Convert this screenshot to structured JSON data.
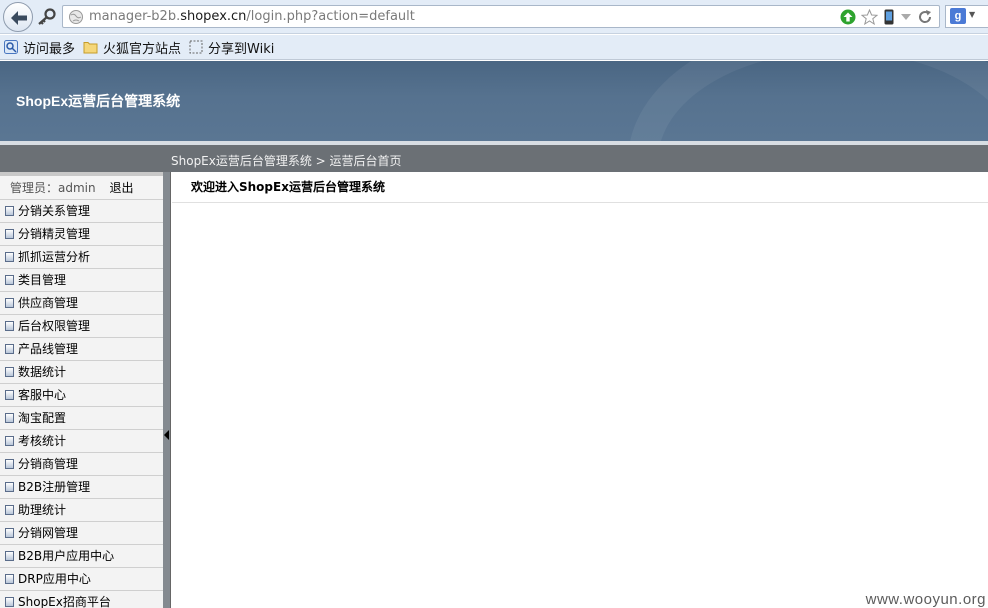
{
  "browser": {
    "url_prefix": "manager-b2b.",
    "url_domain": "shopex.cn",
    "url_path": "/login.php?action=default"
  },
  "bookmarks": [
    {
      "label": "访问最多",
      "icon": "most-visited-icon"
    },
    {
      "label": "火狐官方站点",
      "icon": "folder-icon"
    },
    {
      "label": "分享到Wiki",
      "icon": "share-icon"
    }
  ],
  "header": {
    "title": "ShopEx运营后台管理系统"
  },
  "breadcrumb": "ShopEx运营后台管理系统 > 运营后台首页",
  "sidebar": {
    "admin_label": "管理员：admin",
    "logout_label": "退出",
    "items": [
      {
        "label": "分销关系管理"
      },
      {
        "label": "分销精灵管理"
      },
      {
        "label": "抓抓运营分析"
      },
      {
        "label": "类目管理"
      },
      {
        "label": "供应商管理"
      },
      {
        "label": "后台权限管理"
      },
      {
        "label": "产品线管理"
      },
      {
        "label": "数据统计"
      },
      {
        "label": "客服中心"
      },
      {
        "label": "淘宝配置"
      },
      {
        "label": "考核统计"
      },
      {
        "label": "分销商管理"
      },
      {
        "label": "B2B注册管理"
      },
      {
        "label": "助理统计"
      },
      {
        "label": "分销网管理"
      },
      {
        "label": "B2B用户应用中心"
      },
      {
        "label": "DRP应用中心"
      },
      {
        "label": "ShopEx招商平台"
      }
    ]
  },
  "main": {
    "welcome": "欢迎进入ShopEx运营后台管理系统"
  },
  "watermark": "www.wooyun.org"
}
